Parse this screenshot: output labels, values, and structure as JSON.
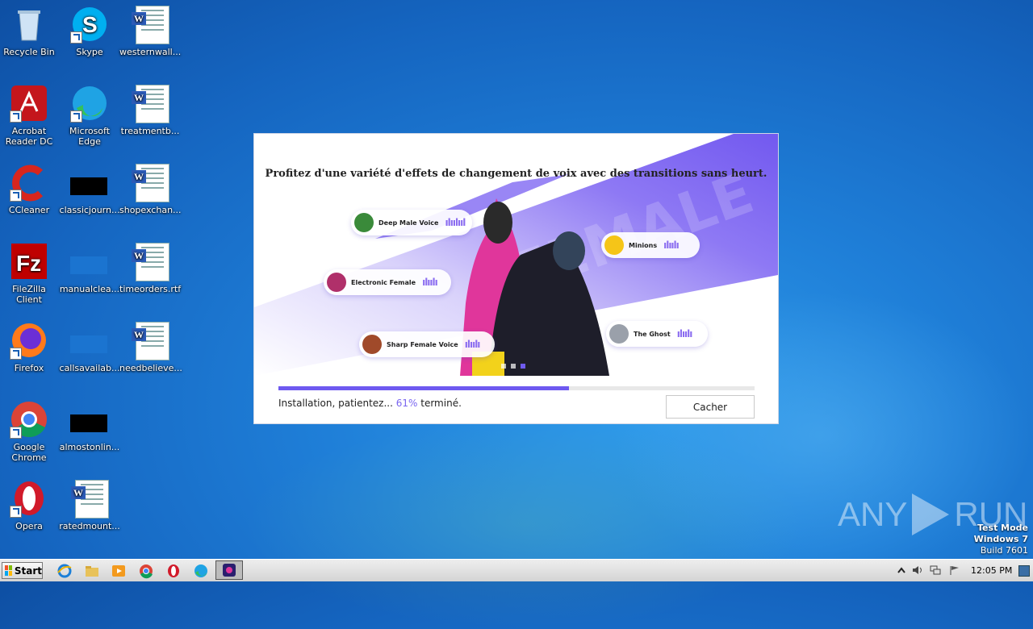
{
  "desktop_icons": [
    {
      "label": "Recycle Bin",
      "icon": "recycle-bin-icon"
    },
    {
      "label": "Skype",
      "icon": "skype-icon"
    },
    {
      "label": "westernwall...",
      "icon": "word-doc-icon"
    },
    {
      "label": "Acrobat Reader DC",
      "icon": "acrobat-icon"
    },
    {
      "label": "Microsoft Edge",
      "icon": "edge-icon"
    },
    {
      "label": "treatmentb...",
      "icon": "word-doc-icon"
    },
    {
      "label": "CCleaner",
      "icon": "ccleaner-icon"
    },
    {
      "label": "classicjourn...",
      "icon": "black-file-icon"
    },
    {
      "label": "shopexchan...",
      "icon": "word-doc-icon"
    },
    {
      "label": "FileZilla Client",
      "icon": "filezilla-icon"
    },
    {
      "label": "manualclea...",
      "icon": "blue-file-icon"
    },
    {
      "label": "timeorders.rtf",
      "icon": "word-doc-icon"
    },
    {
      "label": "Firefox",
      "icon": "firefox-icon"
    },
    {
      "label": "callsavailab...",
      "icon": "blue-file-icon"
    },
    {
      "label": "needbelieve...",
      "icon": "word-doc-icon"
    },
    {
      "label": "Google Chrome",
      "icon": "chrome-icon"
    },
    {
      "label": "almostonlin...",
      "icon": "black-file-icon"
    },
    {
      "label": "Opera",
      "icon": "opera-icon"
    },
    {
      "label": "ratedmount...",
      "icon": "word-doc-icon"
    }
  ],
  "installer": {
    "headline": "Profitez d'une variété d'effets de changement de voix avec des transitions sans heurt.",
    "voice_pills": [
      "Deep Male Voice",
      "Minions",
      "Electronic Female",
      "The Ghost",
      "Sharp Female Voice"
    ],
    "progress_percent": 61,
    "status_prefix": "Installation, patientez...",
    "status_percent": "61%",
    "status_suffix": "terminé.",
    "hide_button": "Cacher",
    "accent_color": "#6e59f0"
  },
  "watermark": {
    "left": "ANY",
    "right": "RUN"
  },
  "test_mode": {
    "line1": "Test Mode",
    "line2": "Windows 7",
    "line3": "Build 7601"
  },
  "taskbar": {
    "start_label": "Start",
    "clock": "12:05 PM"
  }
}
